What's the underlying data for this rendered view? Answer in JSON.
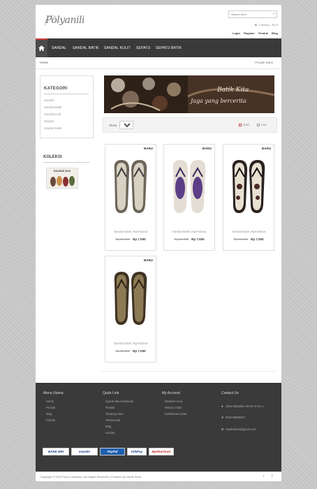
{
  "header": {
    "logo": "Polyanili",
    "search_placeholder": "Search here",
    "cart": "0 item(s) - Rp 0",
    "top_links": [
      "Login",
      "Register",
      "Produk",
      "Blog"
    ]
  },
  "nav": {
    "items": [
      "SANDAL",
      "SANDAL BATIK",
      "SANDAL KULIT",
      "SEPATU",
      "SEPATU BATIK"
    ]
  },
  "breadcrumb": {
    "home": "Home",
    "current": "Produk Kami"
  },
  "sidebar": {
    "kategori_title": "KATEGORI",
    "kategori_items": [
      "Sandal",
      "Sandal Batik",
      "Sandal Kulit",
      "Sepatu",
      "Sepatu Batik"
    ],
    "koleksi_title": "KOLEKSI",
    "koleksi_label": "KOLEKSI 2019"
  },
  "banner": {
    "line1": "Batik Kita",
    "line2": "Jaga yang bercerita"
  },
  "toolbar": {
    "show_label": "Show",
    "show_value": "15",
    "grid_label": "Grid",
    "list_label": "List"
  },
  "products": [
    {
      "badge": "BARU",
      "name": "Sandal Batik Jepit Biasa",
      "old_price": "Rp 12.000",
      "new_price": "Rp 7.000"
    },
    {
      "badge": "BARU",
      "name": "Sandal Batik Jepit Biasa",
      "old_price": "Rp 12.000",
      "new_price": "Rp 7.000"
    },
    {
      "badge": "BARU",
      "name": "Sandal Batik Jepit Biasa",
      "old_price": "Rp 12.000",
      "new_price": "Rp 7.000"
    },
    {
      "badge": "BARU",
      "name": "Sandal Batik Jepit Biasa",
      "old_price": "Rp 12.000",
      "new_price": "Rp 7.000"
    }
  ],
  "footer": {
    "menu_title": "Menu Utama",
    "menu_items": [
      "Home",
      "Produk",
      "Blog",
      "Kontak"
    ],
    "quick_title": "Quick Link",
    "quick_items": [
      "Syarat dan Ketentuan",
      "Produk",
      "Tentang Kami",
      "Testimonial",
      "Blog",
      "Kontak"
    ],
    "account_title": "My Account",
    "account_items": [
      "Member Area",
      "History Order",
      "Konfirmasi Order"
    ],
    "contact_title": "Contact Us",
    "address": "Jalan Babakan Jeruk VI No 1",
    "phone": "082219805007",
    "email": "nawkoleksi@gmail.com",
    "banks": [
      "BANK BRI",
      "mandiri",
      "PayPal",
      "KlikPay",
      "MyShortCart"
    ],
    "copyright": "Copyright © 2015 Putra Collection | All Rights Reserved | Powered by Jarvis Store"
  }
}
